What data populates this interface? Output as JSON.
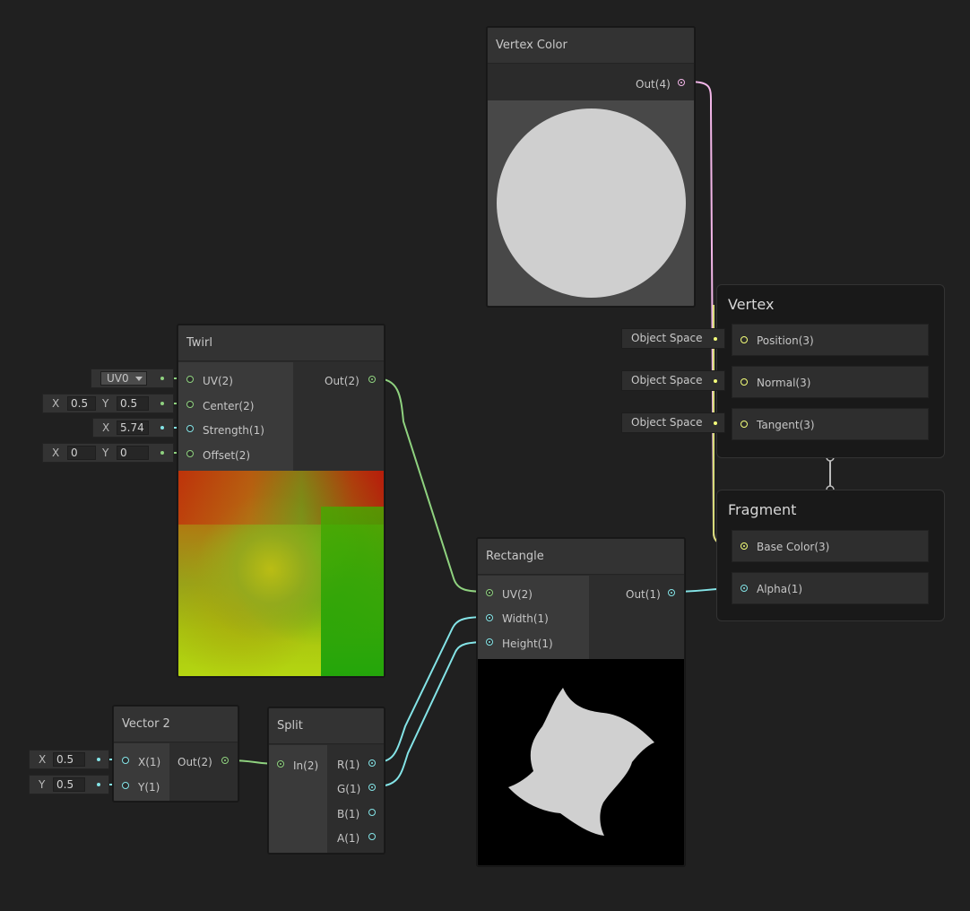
{
  "nodes": {
    "vertex_color": {
      "title": "Vertex Color",
      "out": "Out(4)"
    },
    "twirl": {
      "title": "Twirl",
      "inputs": [
        "UV(2)",
        "Center(2)",
        "Strength(1)",
        "Offset(2)"
      ],
      "out": "Out(2)",
      "uv_select": "UV0",
      "center": {
        "x_label": "X",
        "x": "0.5",
        "y_label": "Y",
        "y": "0.5"
      },
      "strength": {
        "x_label": "X",
        "x": "5.74"
      },
      "offset": {
        "x_label": "X",
        "x": "0",
        "y_label": "Y",
        "y": "0"
      }
    },
    "rectangle": {
      "title": "Rectangle",
      "inputs": [
        "UV(2)",
        "Width(1)",
        "Height(1)"
      ],
      "out": "Out(1)"
    },
    "vector2": {
      "title": "Vector 2",
      "inputs": [
        "X(1)",
        "Y(1)"
      ],
      "out": "Out(2)",
      "x_field": {
        "label": "X",
        "value": "0.5"
      },
      "y_field": {
        "label": "Y",
        "value": "0.5"
      }
    },
    "split": {
      "title": "Split",
      "input": "In(2)",
      "outputs": [
        "R(1)",
        "G(1)",
        "B(1)",
        "A(1)"
      ]
    }
  },
  "master": {
    "vertex": {
      "title": "Vertex",
      "slots": [
        "Position(3)",
        "Normal(3)",
        "Tangent(3)"
      ],
      "space_labels": [
        "Object Space",
        "Object Space",
        "Object Space"
      ]
    },
    "fragment": {
      "title": "Fragment",
      "slots": [
        "Base Color(3)",
        "Alpha(1)"
      ]
    }
  },
  "colors": {
    "vector1": "#84e4e7",
    "vector2": "#8fd27f",
    "vector3": "#f4ff7a",
    "vector4": "#f2b6e8",
    "background": "#202020"
  }
}
